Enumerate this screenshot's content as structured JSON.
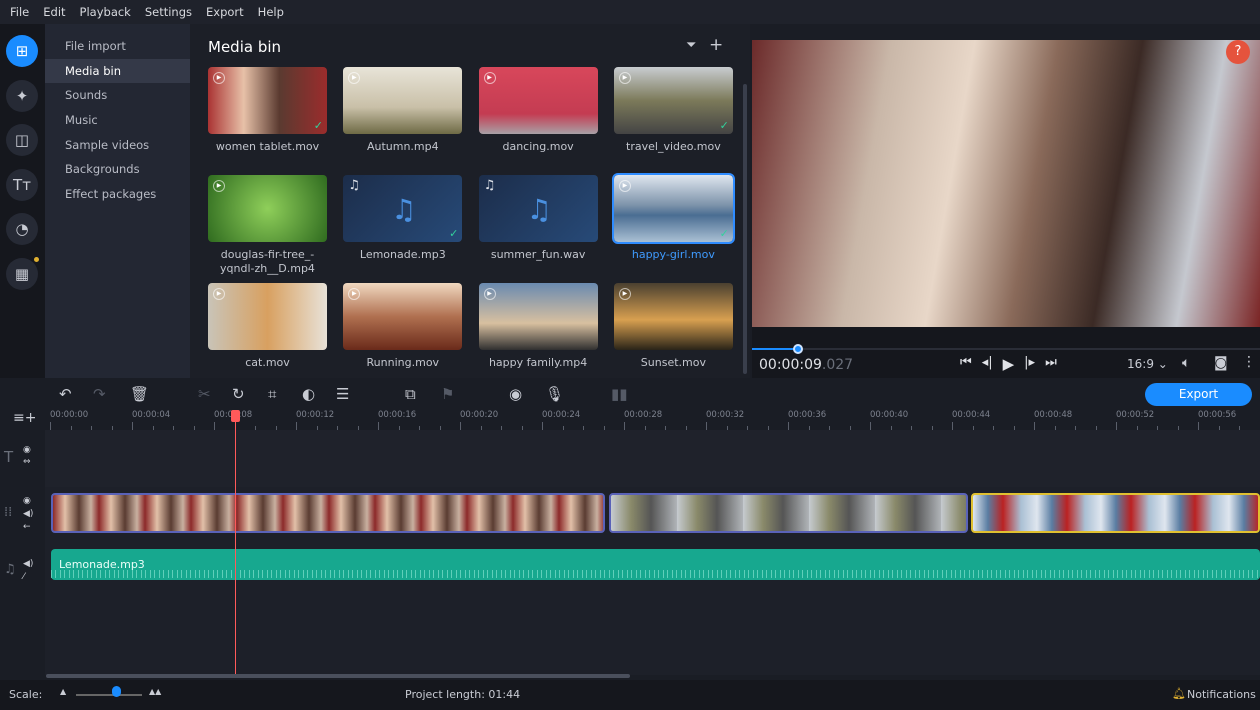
{
  "menu": [
    "File",
    "Edit",
    "Playback",
    "Settings",
    "Export",
    "Help"
  ],
  "rail": [
    {
      "icon": "import-icon",
      "glyph": "⊞"
    },
    {
      "icon": "magic-wand-icon",
      "glyph": "✦"
    },
    {
      "icon": "transitions-icon",
      "glyph": "◫"
    },
    {
      "icon": "titles-icon",
      "glyph": "Tт"
    },
    {
      "icon": "stickers-icon",
      "glyph": "◔"
    },
    {
      "icon": "more-tools-icon",
      "glyph": "▦"
    }
  ],
  "categories": [
    "File import",
    "Media bin",
    "Sounds",
    "Music",
    "Sample videos",
    "Backgrounds",
    "Effect packages"
  ],
  "selected_category": "Media bin",
  "bin": {
    "title": "Media bin",
    "items": [
      {
        "name": "women tablet.mov",
        "type": "video",
        "check": true,
        "bg": "linear-gradient(90deg,#a33 0%,#e7c1a8 30%,#5a3a30 60%,#9b2c2c 100%)"
      },
      {
        "name": "Autumn.mp4",
        "type": "video",
        "check": false,
        "bg": "linear-gradient(180deg,#e8e4d8,#c9c0a8 60%,#6e6a45)"
      },
      {
        "name": "dancing.mov",
        "type": "video",
        "check": false,
        "bg": "linear-gradient(180deg,#d8475b,#c43c52 70%,#a8a0a6)"
      },
      {
        "name": "travel_video.mov",
        "type": "video",
        "check": true,
        "bg": "linear-gradient(180deg,#c8ccd0,#7c7a5a 50%,#444 100%)"
      },
      {
        "name": "douglas-fir-tree_-yqndl-zh__D.mp4",
        "type": "video",
        "check": false,
        "bg": "radial-gradient(circle,#8fcf5a,#2f6b1f)"
      },
      {
        "name": "Lemonade.mp3",
        "type": "audio",
        "check": true,
        "bg": "linear-gradient(135deg,#1c2d4a,#274a78)"
      },
      {
        "name": "summer_fun.wav",
        "type": "audio",
        "check": false,
        "bg": "linear-gradient(135deg,#1c2d4a,#274a78)"
      },
      {
        "name": "happy-girl.mov",
        "type": "video",
        "check": true,
        "selected": true,
        "bg": "linear-gradient(180deg,#dfe6ef,#7d93aa 45%,#4a6d92 60%,#aac0d4)"
      },
      {
        "name": "cat.mov",
        "type": "video",
        "check": false,
        "bg": "linear-gradient(90deg,#c9c4b8,#d8a060 50%,#e8e2d8)"
      },
      {
        "name": "Running.mov",
        "type": "video",
        "check": false,
        "bg": "linear-gradient(180deg,#f0d8c0,#b07050 50%,#6a2a1a)"
      },
      {
        "name": "happy family.mp4",
        "type": "video",
        "check": false,
        "bg": "linear-gradient(180deg,#6a8ab0,#d8c0a0 60%,#303030)"
      },
      {
        "name": "Sunset.mov",
        "type": "video",
        "check": false,
        "bg": "linear-gradient(180deg,#4a4030,#d8a050 55%,#2a2418)"
      }
    ]
  },
  "player": {
    "time_main": "00:00:09",
    "time_ms": ".027",
    "progress_fraction": 0.09,
    "aspect": "16:9",
    "help": "?"
  },
  "toolbar": {
    "export_label": "Export"
  },
  "timeline": {
    "ruler": [
      "00:00:00",
      "00:00:04",
      "00:00:08",
      "00:00:12",
      "00:00:16",
      "00:00:20",
      "00:00:24",
      "00:00:28",
      "00:00:32",
      "00:00:36",
      "00:00:40",
      "00:00:44",
      "00:00:48",
      "00:00:52",
      "00:00:56"
    ],
    "playhead_seconds": 9,
    "audio_clip": "Lemonade.mp3"
  },
  "status": {
    "scale_label": "Scale:",
    "scale_fraction": 0.6,
    "project_length": "Project length: 01:44",
    "notifications": "Notifications"
  },
  "colors": {
    "accent": "#1a8cff",
    "audio": "#17a88f",
    "playhead": "#ff5a5a"
  }
}
